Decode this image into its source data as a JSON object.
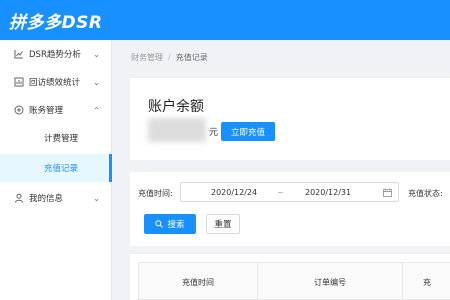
{
  "header": {
    "logo": "拼多多DSR"
  },
  "sidebar": {
    "items": [
      {
        "label": "DSR趋势分析",
        "arrow": "⌄"
      },
      {
        "label": "回访绩效统计",
        "arrow": "⌄"
      },
      {
        "label": "账务管理",
        "arrow": "⌃"
      },
      {
        "label": "计费管理"
      },
      {
        "label": "充值记录"
      },
      {
        "label": "我的信息",
        "arrow": "⌄"
      }
    ]
  },
  "breadcrumb": {
    "parent": "财务管理",
    "separator": "/",
    "current": "充值记录"
  },
  "account": {
    "title": "账户余额",
    "unit": "元",
    "recharge_label": "立即充值"
  },
  "filter": {
    "time_label": "充值时间:",
    "start_date": "2020/12/24",
    "tilde": "~",
    "end_date": "2020/12/31",
    "status_label": "充值状态:",
    "search_label": "搜索",
    "reset_label": "重置"
  },
  "table": {
    "columns": [
      "充值时间",
      "订单编号",
      "充"
    ]
  },
  "colors": {
    "primary": "#1890ff",
    "active_bg": "#e6f7ff"
  }
}
